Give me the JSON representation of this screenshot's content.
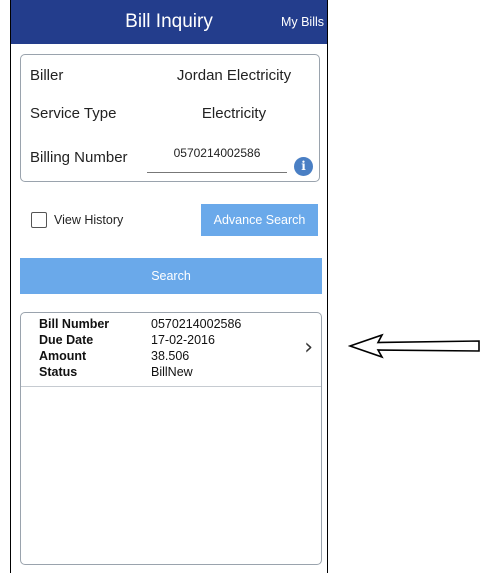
{
  "header": {
    "title": "Bill Inquiry",
    "my_bills": "My Bills"
  },
  "form": {
    "biller_label": "Biller",
    "biller_value": "Jordan Electricity",
    "service_type_label": "Service Type",
    "service_type_value": "Electricity",
    "billing_number_label": "Billing Number",
    "billing_number_value": "0570214002586",
    "info_icon": "info-icon"
  },
  "options": {
    "view_history_label": "View History",
    "view_history_checked": false,
    "advance_search_label": "Advance Search"
  },
  "search_label": "Search",
  "results": [
    {
      "bill_number_label": "Bill Number",
      "bill_number": "0570214002586",
      "due_date_label": "Due Date",
      "due_date": "17-02-2016",
      "amount_label": "Amount",
      "amount": "38.506",
      "status_label": "Status",
      "status": "BillNew"
    }
  ],
  "colors": {
    "header": "#233d8c",
    "button": "#6aa9ea",
    "info_icon": "#4a7fc4"
  }
}
